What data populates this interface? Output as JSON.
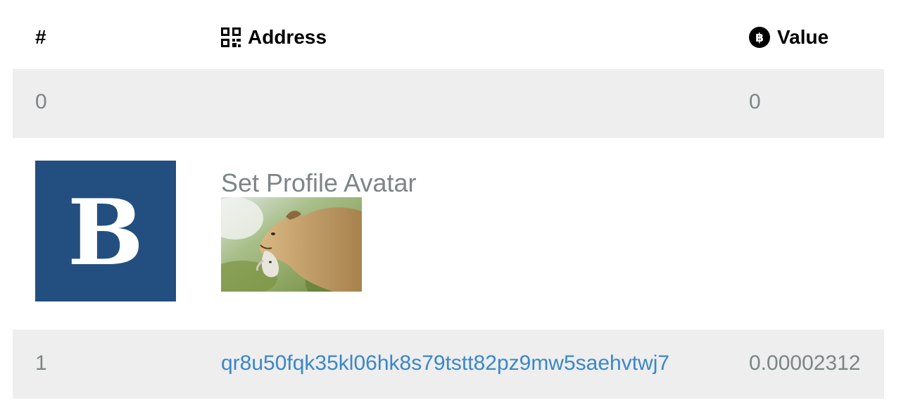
{
  "table": {
    "headers": {
      "index": "#",
      "address": "Address",
      "value": "Value",
      "address_icon": "qr-code-icon",
      "value_icon": "bitcoin-icon"
    },
    "rows": [
      {
        "index": "0",
        "address": "",
        "value": "0"
      },
      {
        "index": "1",
        "address": "qr8u50fqk35kl06hk8s79tstt82pz9mw5saehvtwj7",
        "value": "0.00002312"
      }
    ],
    "op_return": {
      "logo_letter": "B",
      "logo_color": "#224f80",
      "action": "Set Profile Avatar",
      "image": "lioness-carrying-cub-photo"
    }
  },
  "colors": {
    "row_shade": "#eeeeee",
    "muted_text": "#7d8587",
    "link": "#3a87c9"
  }
}
